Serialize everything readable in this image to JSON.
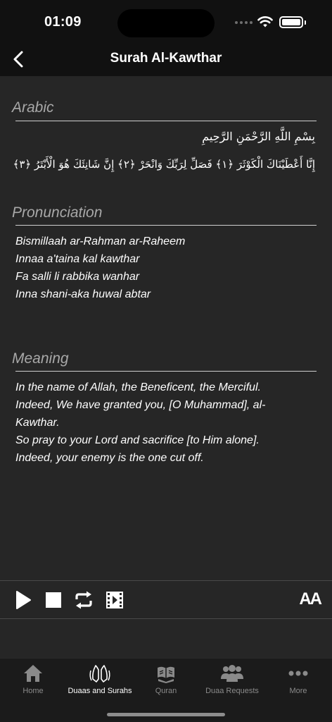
{
  "status_bar": {
    "time": "01:09"
  },
  "nav": {
    "title": "Surah Al-Kawthar"
  },
  "sections": {
    "arabic": {
      "heading": "Arabic",
      "lines": [
        "بِسْمِ اللَّهِ الرَّحْمَنِ الرَّحِيمِ",
        "إِنَّا أَعْطَيْنَاكَ الْكَوْثَرَ ﴿١﴾ فَصَلِّ لِرَبِّكَ وَانْحَرْ ﴿٢﴾ إِنَّ شَانِئَكَ هُوَ الْأَبْتَرُ ﴿٣﴾"
      ]
    },
    "pronunciation": {
      "heading": "Pronunciation",
      "lines": [
        "Bismillaah ar-Rahman ar-Raheem",
        "Innaa a'taina kal kawthar",
        "Fa salli li rabbika wanhar",
        "Inna shani-aka huwal abtar"
      ]
    },
    "meaning": {
      "heading": "Meaning",
      "lines": [
        "In the name of Allah, the Beneficent, the Merciful.",
        "Indeed, We have granted you, [O Muhammad], al-\nKawthar.",
        "So pray to your Lord and sacrifice [to Him alone].",
        "Indeed, your enemy is the one cut off."
      ]
    }
  },
  "player": {
    "play_icon": "play-icon",
    "stop_icon": "stop-icon",
    "repeat_icon": "repeat-icon",
    "video_icon": "video-icon",
    "font_size_label": "AA"
  },
  "tabs": [
    {
      "label": "Home",
      "icon": "home-icon",
      "active": false
    },
    {
      "label": "Duaas and Surahs",
      "icon": "praying-hands-icon",
      "active": true
    },
    {
      "label": "Quran",
      "icon": "quran-book-icon",
      "active": false
    },
    {
      "label": "Duaa Requests",
      "icon": "people-group-icon",
      "active": false
    },
    {
      "label": "More",
      "icon": "more-dots-icon",
      "active": false
    }
  ],
  "colors": {
    "background": "#262626",
    "bars": "#111111",
    "tab_bar": "#1b1b1b",
    "heading_text": "#a8a8a8",
    "inactive_tab": "#8a8a8a",
    "active_tab": "#ffffff"
  }
}
